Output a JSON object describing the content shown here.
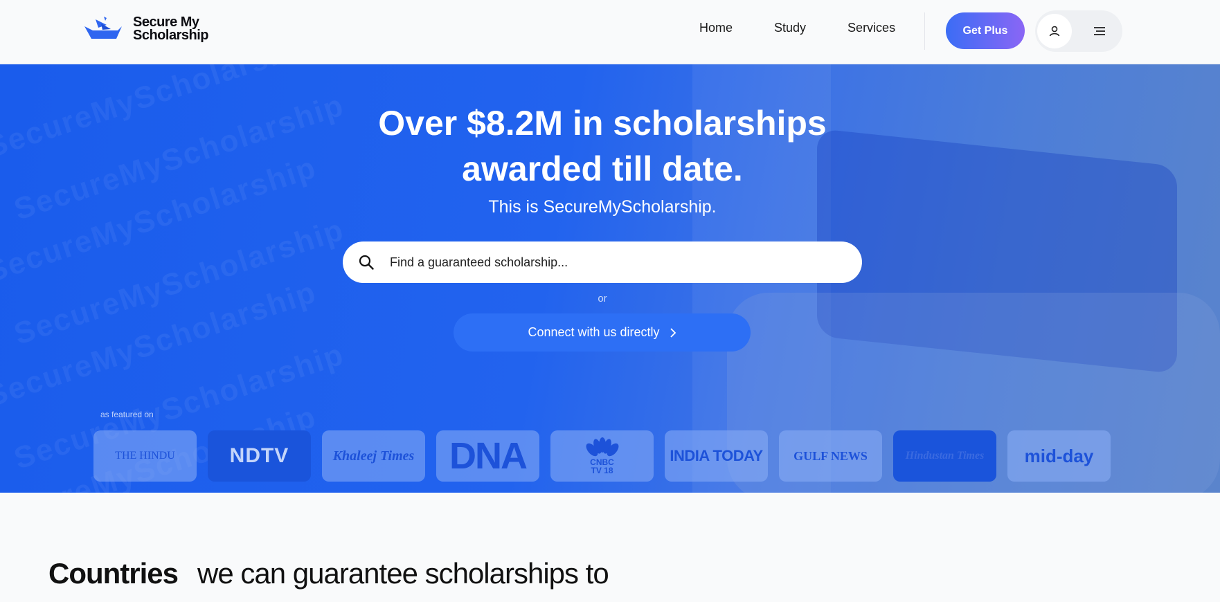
{
  "header": {
    "logo_line1": "Secure My",
    "logo_line2": "Scholarship",
    "nav": [
      "Home",
      "Study",
      "Services"
    ],
    "cta": "Get Plus"
  },
  "hero": {
    "title_line1": "Over $8.2M in scholarships",
    "title_line2": "awarded till date.",
    "subtitle": "This is SecureMyScholarship.",
    "search_placeholder": "Find a guaranteed scholarship...",
    "or_text": "or",
    "connect_label": "Connect with us directly",
    "featured_label": "as featured on",
    "watermark": "SecureMyScholarship",
    "press": [
      {
        "name": "THE HINDU"
      },
      {
        "name": "NDTV"
      },
      {
        "name": "Khaleej Times"
      },
      {
        "name": "DNA"
      },
      {
        "name": "CNBC",
        "sub": "TV 18"
      },
      {
        "name": "INDIA TODAY"
      },
      {
        "name": "GULF NEWS"
      },
      {
        "name": "Hindustan Times"
      },
      {
        "name": "mid-day"
      }
    ]
  },
  "section": {
    "bold": "Countries",
    "rest": "we can guarantee scholarships to"
  },
  "colors": {
    "hero_blue": "#1a5cec",
    "cta_gradient_start": "#3b6df5",
    "cta_gradient_end": "#8a66f5",
    "connect_button": "#2d6ff5"
  }
}
